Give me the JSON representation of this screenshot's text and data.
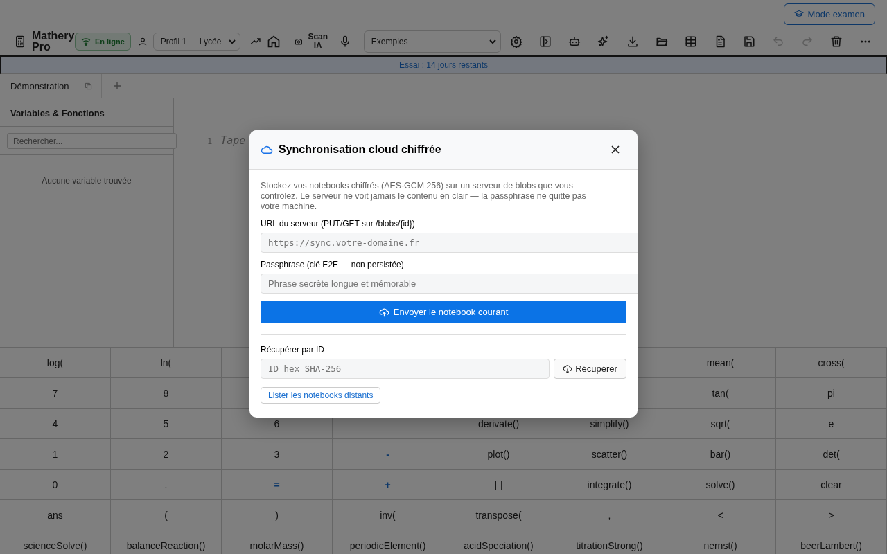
{
  "exam_button": {
    "label": "Mode examen"
  },
  "toolbar": {
    "app_name": "Mathery Pro",
    "status": {
      "label": "En ligne",
      "online": true
    },
    "profile": {
      "value": "Profil 1 — Lycée"
    },
    "scan": {
      "label": "Scan IA"
    },
    "examples": {
      "value": "Exemples"
    },
    "tools": [
      {
        "kind": "gear",
        "disabled": false
      },
      {
        "kind": "panel",
        "disabled": false
      },
      {
        "kind": "robot",
        "disabled": false
      },
      {
        "kind": "sparkles",
        "disabled": false
      },
      {
        "kind": "download",
        "disabled": false
      },
      {
        "kind": "folder",
        "disabled": false
      },
      {
        "kind": "table",
        "disabled": false
      },
      {
        "kind": "document",
        "disabled": false
      },
      {
        "kind": "save",
        "disabled": false
      },
      {
        "kind": "undo",
        "disabled": true
      },
      {
        "kind": "redo",
        "disabled": true
      },
      {
        "kind": "trash",
        "disabled": false
      },
      {
        "kind": "more",
        "disabled": false
      }
    ]
  },
  "trial_banner": "Essai : 14 jours restants",
  "tabs": [
    {
      "label": "Démonstration",
      "selected": true
    }
  ],
  "sidebar": {
    "title": "Variables & Fonctions",
    "search_placeholder": "Rechercher...",
    "empty_text": "Aucune variable trouvée"
  },
  "editor": {
    "line_number": "1",
    "placeholder": "Tape"
  },
  "keypad": [
    [
      {
        "label": "log(",
        "kind": "fn"
      },
      {
        "label": "ln(",
        "kind": "fn"
      },
      {
        "kind": "hidden"
      },
      {
        "kind": "covered"
      },
      {
        "kind": "covered"
      },
      {
        "kind": "hidden"
      },
      {
        "label": "mean(",
        "kind": "fn"
      },
      {
        "label": "cross(",
        "kind": "fn"
      }
    ],
    [
      {
        "label": "7",
        "kind": "fn"
      },
      {
        "label": "8",
        "kind": "fn"
      },
      {
        "kind": "hidden"
      },
      {
        "kind": "covered"
      },
      {
        "kind": "covered"
      },
      {
        "kind": "hidden"
      },
      {
        "label": "tan(",
        "kind": "fn"
      },
      {
        "label": "pi",
        "kind": "fn"
      }
    ],
    [
      {
        "label": "4",
        "kind": "fn"
      },
      {
        "label": "5",
        "kind": "fn"
      },
      {
        "label": "6",
        "kind": "fn"
      },
      {
        "kind": "hidden"
      },
      {
        "label": "derivate()",
        "kind": "fn"
      },
      {
        "label": "simplify()",
        "kind": "fn"
      },
      {
        "label": "sqrt(",
        "kind": "fn"
      },
      {
        "label": "e",
        "kind": "fn"
      }
    ],
    [
      {
        "label": "1",
        "kind": "fn"
      },
      {
        "label": "2",
        "kind": "fn"
      },
      {
        "label": "3",
        "kind": "fn"
      },
      {
        "label": "-",
        "kind": "op"
      },
      {
        "label": "plot()",
        "kind": "fn"
      },
      {
        "label": "scatter()",
        "kind": "fn"
      },
      {
        "label": "bar()",
        "kind": "fn"
      },
      {
        "label": "det(",
        "kind": "fn"
      }
    ],
    [
      {
        "label": "0",
        "kind": "fn"
      },
      {
        "label": ".",
        "kind": "fn"
      },
      {
        "label": "=",
        "kind": "op"
      },
      {
        "label": "+",
        "kind": "op"
      },
      {
        "label": "[ ]",
        "kind": "fn"
      },
      {
        "label": "integrate()",
        "kind": "fn"
      },
      {
        "label": "solve()",
        "kind": "fn"
      },
      {
        "label": "clear",
        "kind": "fn"
      }
    ],
    [
      {
        "label": "ans",
        "kind": "fn"
      },
      {
        "label": "(",
        "kind": "fn"
      },
      {
        "label": ")",
        "kind": "fn"
      },
      {
        "label": "inv(",
        "kind": "fn"
      },
      {
        "label": "transpose(",
        "kind": "fn"
      },
      {
        "label": ",",
        "kind": "fn"
      },
      {
        "label": "<",
        "kind": "fn"
      },
      {
        "label": ">",
        "kind": "fn"
      }
    ],
    [
      {
        "label": "scienceSolve()",
        "kind": "fn"
      },
      {
        "label": "balanceReaction()",
        "kind": "fn"
      },
      {
        "label": "molarMass()",
        "kind": "fn"
      },
      {
        "label": "periodicElement()",
        "kind": "fn"
      },
      {
        "label": "acidSpeciation()",
        "kind": "fn"
      },
      {
        "label": "titrationStrong()",
        "kind": "fn"
      },
      {
        "label": "nernst()",
        "kind": "fn"
      },
      {
        "label": "beerLambert()",
        "kind": "fn"
      }
    ]
  ],
  "dialog": {
    "title": "Synchronisation cloud chiffrée",
    "description": "Stockez vos notebooks chiffrés (AES-GCM 256) sur un serveur de blobs que vous contrôlez. Le serveur ne voit jamais le contenu en clair — la passphrase ne quitte pas votre machine.",
    "url_label": "URL du serveur (PUT/GET sur /blobs/{id})",
    "url_placeholder": "https://sync.votre-domaine.fr",
    "pass_label": "Passphrase (clé E2E — non persistée)",
    "pass_placeholder": "Phrase secrète longue et mémorable",
    "upload_button": "Envoyer le notebook courant",
    "fetch_label": "Récupérer par ID",
    "fetch_placeholder": "ID hex SHA-256",
    "fetch_button": "Récupérer",
    "list_button": "Lister les notebooks distants"
  }
}
